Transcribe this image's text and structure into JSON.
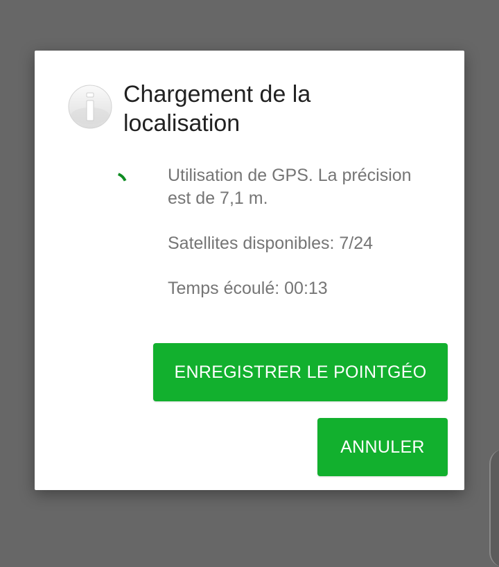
{
  "dialog": {
    "icon": "info-icon",
    "title": "Chargement de la localisation",
    "messages": {
      "gps_accuracy": "Utilisation de GPS. La précision est de 7,1 m.",
      "satellites": "Satellites disponibles: 7/24",
      "elapsed": "Temps écoulé: 00:13"
    },
    "buttons": {
      "save": "ENREGISTRER LE POINTGÉO",
      "cancel": "ANNULER"
    }
  },
  "colors": {
    "accent": "#12b02e",
    "spinner": "#0e8c22",
    "scrim": "#676767"
  }
}
